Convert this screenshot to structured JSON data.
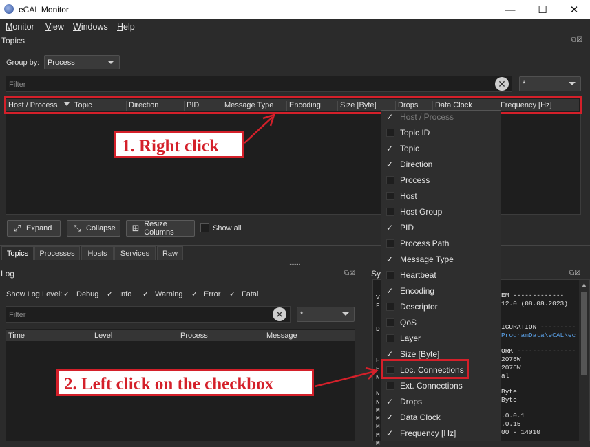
{
  "window": {
    "title": "eCAL Monitor",
    "minimize": "—",
    "maximize": "☐",
    "close": "✕"
  },
  "menubar": [
    "Monitor",
    "View",
    "Windows",
    "Help"
  ],
  "topics": {
    "dock_title": "Topics",
    "group_by_label": "Group by:",
    "group_by_value": "Process",
    "filter_placeholder": "Filter",
    "filter_combo_value": "*",
    "columns": [
      "Host / Process",
      "Topic",
      "Direction",
      "PID",
      "Message Type",
      "Encoding",
      "Size [Byte]",
      "Drops",
      "Data Clock",
      "Frequency [Hz]"
    ],
    "buttons": {
      "expand": "Expand",
      "collapse": "Collapse",
      "resize": "Resize Columns"
    },
    "show_all_label": "Show all"
  },
  "tabs": [
    "Topics",
    "Processes",
    "Hosts",
    "Services",
    "Raw"
  ],
  "splitter_handle": "......",
  "log": {
    "dock_title": "Log",
    "show_log_level_label": "Show Log Level:",
    "levels": [
      "Debug",
      "Info",
      "Warning",
      "Error",
      "Fatal"
    ],
    "filter_placeholder": "Filter",
    "filter_combo_value": "*",
    "columns": [
      "Time",
      "Level",
      "Process",
      "Message"
    ]
  },
  "system_dock_title": "Sy",
  "system_lines": [
    {
      "text": "EM -------------",
      "color": "#e0e0e0"
    },
    {
      "text": "12.0 (08.08.2023)",
      "color": "#e0e0e0"
    },
    {
      "text": "IGURATION ---------",
      "color": "#e0e0e0"
    },
    {
      "text": "ProgramData\\eCAL\\ec",
      "color": "#5aa0e6"
    },
    {
      "text": "ORK ---------------",
      "color": "#e0e0e0"
    },
    {
      "text": "2076W",
      "color": "#e0e0e0"
    },
    {
      "text": "2076W",
      "color": "#e0e0e0"
    },
    {
      "text": "al",
      "color": "#e0e0e0"
    },
    {
      "text": "Byte",
      "color": "#e0e0e0"
    },
    {
      "text": "Byte",
      "color": "#e0e0e0"
    },
    {
      "text": ".0.0.1",
      "color": "#e0e0e0"
    },
    {
      "text": ".0.15",
      "color": "#e0e0e0"
    },
    {
      "text": "00 - 14010",
      "color": "#e0e0e0"
    }
  ],
  "context_menu": [
    {
      "label": "Host / Process",
      "checked": true,
      "disabled": true
    },
    {
      "label": "Topic ID",
      "checked": false
    },
    {
      "label": "Topic",
      "checked": true
    },
    {
      "label": "Direction",
      "checked": true
    },
    {
      "label": "Process",
      "checked": false
    },
    {
      "label": "Host",
      "checked": false
    },
    {
      "label": "Host Group",
      "checked": false
    },
    {
      "label": "PID",
      "checked": true
    },
    {
      "label": "Process Path",
      "checked": false
    },
    {
      "label": "Message Type",
      "checked": true
    },
    {
      "label": "Heartbeat",
      "checked": false
    },
    {
      "label": "Encoding",
      "checked": true
    },
    {
      "label": "Descriptor",
      "checked": false
    },
    {
      "label": "QoS",
      "checked": false
    },
    {
      "label": "Layer",
      "checked": false
    },
    {
      "label": "Size [Byte]",
      "checked": true
    },
    {
      "label": "Loc. Connections",
      "checked": false
    },
    {
      "label": "Ext. Connections",
      "checked": false
    },
    {
      "label": "Drops",
      "checked": true
    },
    {
      "label": "Data Clock",
      "checked": true
    },
    {
      "label": "Frequency [Hz]",
      "checked": true
    }
  ],
  "annotations": {
    "right_click": "1. Right click",
    "left_click": "2. Left click on the checkbox"
  },
  "colors": {
    "highlight": "#d4202a",
    "background": "#2b2b2b",
    "panel": "#1e1e1e"
  },
  "icons": {
    "check": "✓",
    "clear": "✕"
  }
}
